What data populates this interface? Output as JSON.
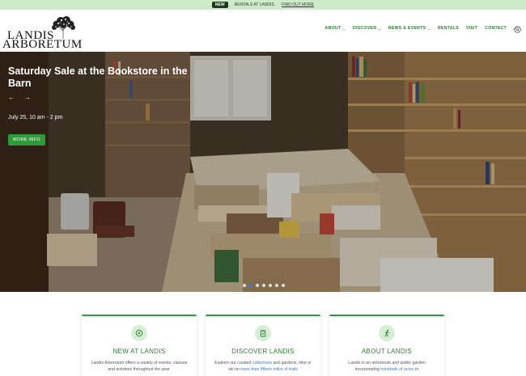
{
  "announcement": {
    "badge": "NEW",
    "text": "RENTALS AT LANDIS.",
    "link": "FIND OUT MORE"
  },
  "logo": {
    "line1": "LANDIS",
    "line2": "ARBORETUM"
  },
  "nav": {
    "items": [
      {
        "label": "ABOUT",
        "has_dropdown": true
      },
      {
        "label": "DISCOVER",
        "has_dropdown": true
      },
      {
        "label": "NEWS & EVENTS",
        "has_dropdown": true
      },
      {
        "label": "RENTALS",
        "has_dropdown": false
      },
      {
        "label": "VISIT",
        "has_dropdown": false
      },
      {
        "label": "CONTACT",
        "has_dropdown": false
      }
    ],
    "search_icon": "search-icon"
  },
  "hero": {
    "title": "Saturday Sale at the Bookstore in the Barn",
    "prev": "←",
    "next": "→",
    "date": "July 25, 10 am - 2 pm",
    "button": "MORE INFO",
    "slide_count": 7,
    "active_slide": 2
  },
  "cards": [
    {
      "title": "NEW AT LANDIS",
      "text": "Landis Arboretum offers a variety of events, classes and activities throughout the year.",
      "icon": "leaf-icon"
    },
    {
      "title": "DISCOVER LANDIS",
      "text_a": "Explore our curated ",
      "link_a": "collections",
      "text_b": " and gardens, hike or ski on ",
      "link_b": "more than fifteen miles of trails",
      "icon": "clipboard-icon"
    },
    {
      "title": "ABOUT LANDIS",
      "text_a": "Landis is an arboretum and public garden incorporating ",
      "link_a": "hundreds of acres",
      "text_b": " in",
      "icon": "walker-icon"
    }
  ],
  "colors": {
    "accent": "#2e9b3b",
    "nav_green": "#2e7d32",
    "announce_bg": "#cdebc9",
    "link_blue": "#2e7dd7"
  }
}
